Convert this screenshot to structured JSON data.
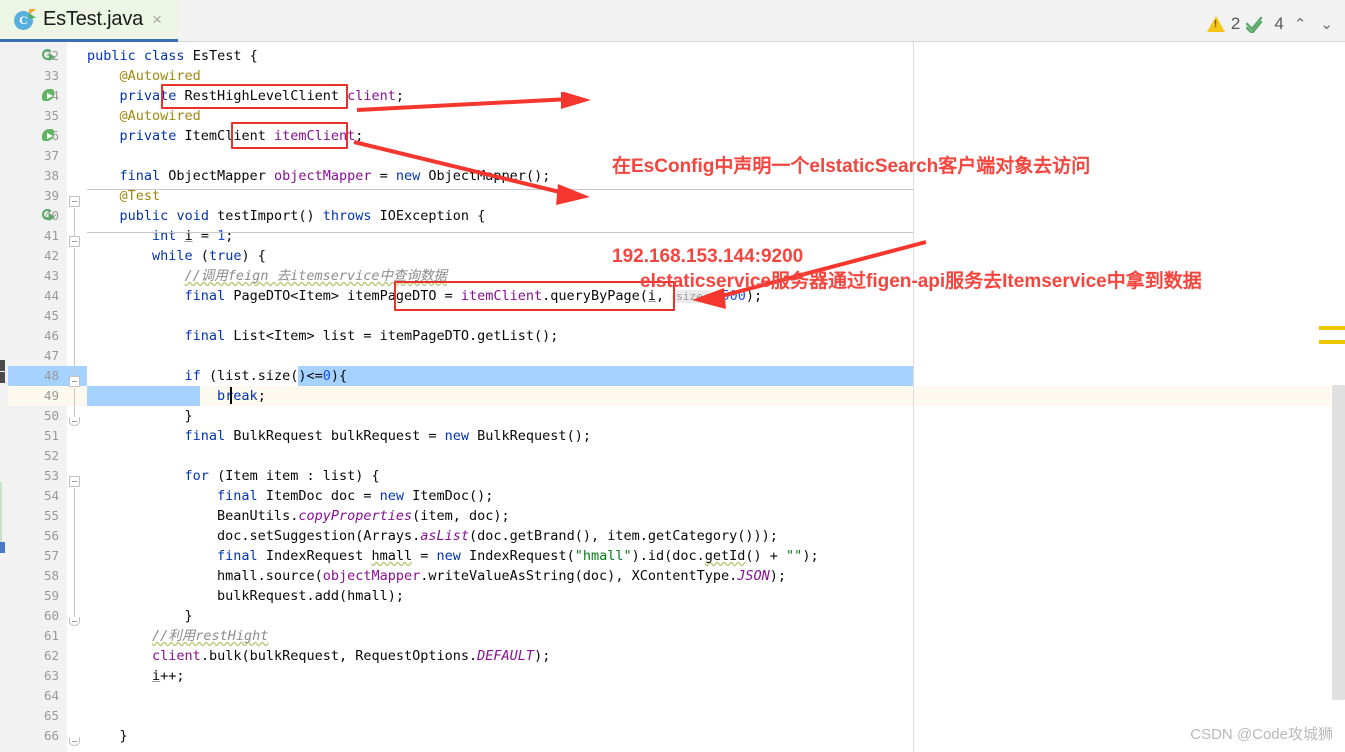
{
  "tab": {
    "title": "EsTest.java",
    "icon": "java-class-icon",
    "close_label": "×"
  },
  "status": {
    "warning_count": "2",
    "check_count": "4",
    "prev_label": "⌃",
    "next_label": "⌄"
  },
  "watermark": "CSDN @Code攻城狮",
  "annotations": [
    {
      "line1": "在EsConfig中声明一个elstaticSearch客户端对象去访问",
      "line2": "192.168.153.144:9200"
    },
    {
      "line1": "elstaticservice服务器通过figen-api服务去Itemservice中拿到数据",
      "line2": ""
    }
  ],
  "colors": {
    "annotation": "#f4463f",
    "redbox": "#e8322a",
    "selection": "#a6d2ff",
    "current_line": "#fdf9ee",
    "warning": "#f5c518",
    "check": "#59a869",
    "tab_active": "#edf6e4",
    "tab_underline": "#3c6eb4"
  },
  "code": {
    "first_line_number": 32,
    "lines": [
      {
        "n": 32,
        "indent": 0,
        "html": "<span class=\"kw\">public</span> <span class=\"kw\">class</span> EsTest {"
      },
      {
        "n": 33,
        "indent": 0,
        "html": "    <span class=\"ann\">@Autowired</span>"
      },
      {
        "n": 34,
        "indent": 0,
        "html": "    <span class=\"kw\">private</span> RestHighLevelClient <span class=\"fld\">client</span>;"
      },
      {
        "n": 35,
        "indent": 0,
        "html": "    <span class=\"ann\">@Autowired</span>"
      },
      {
        "n": 36,
        "indent": 0,
        "html": "    <span class=\"kw\">private</span> ItemClient <span class=\"fld\">itemClient</span>;"
      },
      {
        "n": 37,
        "indent": 0,
        "html": ""
      },
      {
        "n": 38,
        "indent": 0,
        "html": "    <span class=\"kw\">final</span> ObjectMapper <span class=\"fld\">objectMapper</span> = <span class=\"kw\">new</span> ObjectMapper();"
      },
      {
        "n": 39,
        "indent": 0,
        "html": "    <span class=\"ann\">@Test</span>"
      },
      {
        "n": 40,
        "indent": 0,
        "html": "    <span class=\"kw\">public</span> <span class=\"kw\">void</span> testImport() <span class=\"kw\">throws</span> IOException {"
      },
      {
        "n": 41,
        "indent": 0,
        "html": "        <span class=\"kw\">int</span> <span class=\"und\">i</span> = <span class=\"num\">1</span>;"
      },
      {
        "n": 42,
        "indent": 0,
        "html": "        <span class=\"kw\">while</span> (<span class=\"kw\">true</span>) {"
      },
      {
        "n": 43,
        "indent": 0,
        "html": "            <span class=\"cmt sq\">//调用feign 去itemservice中查询数据</span>"
      },
      {
        "n": 44,
        "indent": 0,
        "html": "            <span class=\"kw\">final</span> PageDTO&lt;Item&gt; itemPageDTO = <span class=\"fld\">itemClient</span>.queryByPage(<span class=\"und\">i</span>, <span class=\"hint\">size:</span> <span class=\"num\">500</span>);"
      },
      {
        "n": 45,
        "indent": 0,
        "html": ""
      },
      {
        "n": 46,
        "indent": 0,
        "html": "            <span class=\"kw\">final</span> List&lt;Item&gt; list = itemPageDTO.getList();"
      },
      {
        "n": 47,
        "indent": 0,
        "html": ""
      },
      {
        "n": 48,
        "indent": 0,
        "html": "            <span class=\"kw\">if</span> (list.size()&lt;=<span class=\"num\">0</span>){"
      },
      {
        "n": 49,
        "indent": 0,
        "html": "                <span class=\"kw\">break</span>;"
      },
      {
        "n": 50,
        "indent": 0,
        "html": "            }"
      },
      {
        "n": 51,
        "indent": 0,
        "html": "            <span class=\"kw\">final</span> BulkRequest bulkRequest = <span class=\"kw\">new</span> BulkRequest();"
      },
      {
        "n": 52,
        "indent": 0,
        "html": ""
      },
      {
        "n": 53,
        "indent": 0,
        "html": "            <span class=\"kw\">for</span> (Item item : list) {"
      },
      {
        "n": 54,
        "indent": 0,
        "html": "                <span class=\"kw\">final</span> ItemDoc doc = <span class=\"kw\">new</span> ItemDoc();"
      },
      {
        "n": 55,
        "indent": 0,
        "html": "                BeanUtils.<span class=\"stat\">copyProperties</span>(item, doc);"
      },
      {
        "n": 56,
        "indent": 0,
        "html": "                doc.setSuggestion(Arrays.<span class=\"stat\">asList</span>(doc.getBrand(), item.getCategory()));"
      },
      {
        "n": 57,
        "indent": 0,
        "html": "                <span class=\"kw\">final</span> IndexRequest <span class=\"sq\">hmall</span> = <span class=\"kw\">new</span> IndexRequest(<span class=\"str\">\"hmall\"</span>).id(doc.<span class=\"sq\">getId</span>() + <span class=\"str\">\"\"</span>);"
      },
      {
        "n": 58,
        "indent": 0,
        "html": "                hmall.source(<span class=\"fld\">objectMapper</span>.writeValueAsString(doc), XContentType.<span class=\"stat\">JSON</span>);"
      },
      {
        "n": 59,
        "indent": 0,
        "html": "                bulkRequest.add(hmall);"
      },
      {
        "n": 60,
        "indent": 0,
        "html": "            }"
      },
      {
        "n": 61,
        "indent": 0,
        "html": "        <span class=\"cmt sq\">//利用restHight</span>"
      },
      {
        "n": 62,
        "indent": 0,
        "html": "        <span class=\"fld\">client</span>.bulk(bulkRequest, RequestOptions.<span class=\"stat\">DEFAULT</span>);"
      },
      {
        "n": 63,
        "indent": 0,
        "html": "        <span class=\"und\">i</span>++;"
      },
      {
        "n": 64,
        "indent": 0,
        "html": ""
      },
      {
        "n": 65,
        "indent": 0,
        "html": ""
      },
      {
        "n": 66,
        "indent": 0,
        "html": "    }"
      }
    ],
    "selected_line": 48,
    "current_line": 49
  },
  "gutter_icons": [
    {
      "line": 32,
      "icon": "run-class-icon"
    },
    {
      "line": 34,
      "icon": "spring-bean-icon"
    },
    {
      "line": 36,
      "icon": "spring-bean-icon"
    },
    {
      "line": 40,
      "icon": "run-method-icon"
    }
  ]
}
